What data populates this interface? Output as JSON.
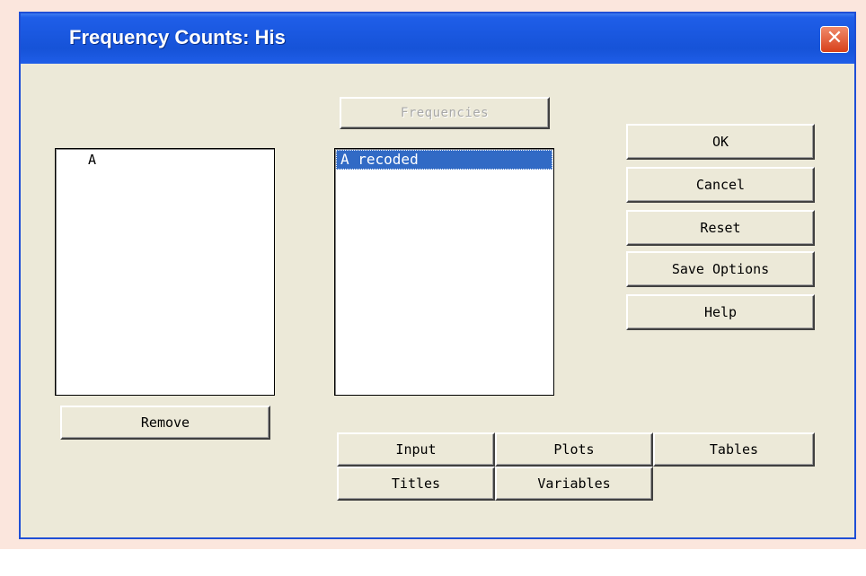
{
  "window": {
    "title": "Frequency Counts: His",
    "close_glyph": "✕"
  },
  "frequencies_button": "Frequencies",
  "left_list": {
    "items": [
      "A"
    ],
    "remove_label": "Remove"
  },
  "right_list": {
    "items": [
      "A recoded"
    ],
    "selected": "A recoded"
  },
  "actions": {
    "ok": "OK",
    "cancel": "Cancel",
    "reset": "Reset",
    "save_options": "Save Options",
    "help": "Help"
  },
  "tabs": {
    "input": "Input",
    "plots": "Plots",
    "tables": "Tables",
    "titles": "Titles",
    "variables": "Variables"
  },
  "colors": {
    "titlebar": "#1653d8",
    "dialog_bg": "#ece9d8",
    "selection": "#316ac5",
    "close_button": "#d8401a"
  }
}
